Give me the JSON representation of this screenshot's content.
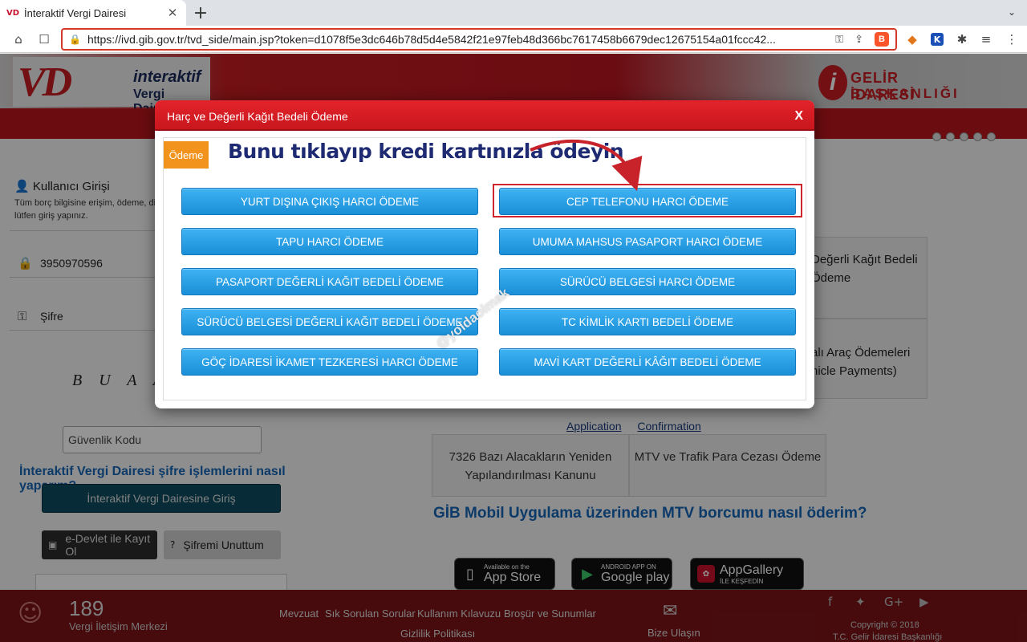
{
  "browser": {
    "tab_title": "İnteraktif Vergi Dairesi",
    "tab_favicon": "VD",
    "url": "https://ivd.gib.gov.tr/tvd_side/main.jsp?token=d1078f5e3dc646b78d5d4e5842f21e97feb48d366bc7617458b6679dec12675154a01fccc42...",
    "icons": [
      "home-icon",
      "bookmark-icon",
      "lock-icon",
      "key-icon",
      "share-icon",
      "brave-shield-icon",
      "metamask-icon",
      "extension-k-icon",
      "puzzle-icon",
      "playlist-icon",
      "menu-icon"
    ]
  },
  "header": {
    "logo_line1": "interaktif",
    "logo_line2": "Vergi Dairesi",
    "logo_mark": "VD",
    "gib_line1": "GELİR İDARESİ",
    "gib_line2": "BAŞKANLIĞI",
    "gib_mark": "i"
  },
  "sidebar": {
    "login_title": "Kullanıcı Girişi",
    "login_desc": "Tüm borç bilgisine erişim, ödeme, di lütfen giriş yapınız.",
    "tc_value": "3950970596",
    "password_placeholder": "Şifre",
    "captcha": "B U A A G",
    "security_code_placeholder": "Güvenlik Kodu",
    "password_help_link": "İnteraktif Vergi Dairesi şifre işlemlerini nasıl yaparım?",
    "login_button": "İnteraktif Vergi Dairesine Giriş",
    "edevlet_button": "e-Devlet ile Kayıt Ol",
    "forgot_button": "Şifremi Unuttum"
  },
  "main": {
    "card1": "Değerli Kağıt Bedeli Ödeme",
    "card2": "alı Araç Ödemeleri hicle Payments)",
    "link_application": "Application",
    "link_confirmation": "Confirmation",
    "card_7326": "7326 Bazı Alacakların Yeniden Yapılandırılması Kanunu",
    "card_mtv": "MTV ve Trafik Para Cezası Ödeme",
    "mtv_question": "GİB Mobil Uygulama üzerinden MTV borcumu nasıl öderim?",
    "appstore_small": "Available on the",
    "appstore_big": "App Store",
    "googleplay_small": "ANDROID APP ON",
    "googleplay_big": "Google play",
    "appgallery_big": "AppGallery",
    "appgallery_small": "İLE KEŞFEDİN"
  },
  "footer": {
    "phone": "189",
    "phone_sub": "Vergi İletişim Merkezi",
    "links": [
      "Mevzuat",
      "Sık Sorulan Sorular",
      "Kullanım Kılavuzu",
      "Broşür ve Sunumlar"
    ],
    "privacy": "Gizlilik Politikası",
    "contact": "Bize Ulaşın",
    "copyright": "Copyright © 2018",
    "copyright2": "T.C. Gelir İdaresi Başkanlığı"
  },
  "modal": {
    "title": "Harç ve Değerli Kağıt Bedeli Ödeme",
    "close": "X",
    "tag": "Ödeme",
    "promo": "Bunu tıklayıp kredi kartınızla ödeyin",
    "watermark": "@yoldaolmak",
    "buttons_left": [
      "YURT DIŞINA ÇIKIŞ HARCI ÖDEME",
      "TAPU HARCI ÖDEME",
      "PASAPORT DEĞERLİ KAĞIT BEDELİ ÖDEME",
      "SÜRÜCÜ BELGESİ DEĞERLİ KAĞIT BEDELİ ÖDEME",
      "GÖÇ İDARESİ İKAMET TEZKERESİ HARCI ÖDEME"
    ],
    "buttons_right": [
      "CEP TELEFONU HARCI ÖDEME",
      "UMUMA MAHSUS PASAPORT HARCI ÖDEME",
      "SÜRÜCÜ BELGESİ HARCI ÖDEME",
      "TC KİMLİK KARTI BEDELİ ÖDEME",
      "MAVİ KART DEĞERLİ KÂĞIT BEDELİ ÖDEME"
    ],
    "colors": {
      "header": "#d81e26",
      "button": "#2aa2e8",
      "tag": "#f2931e",
      "promo": "#1e2a72",
      "highlight": "#d1262e"
    }
  }
}
